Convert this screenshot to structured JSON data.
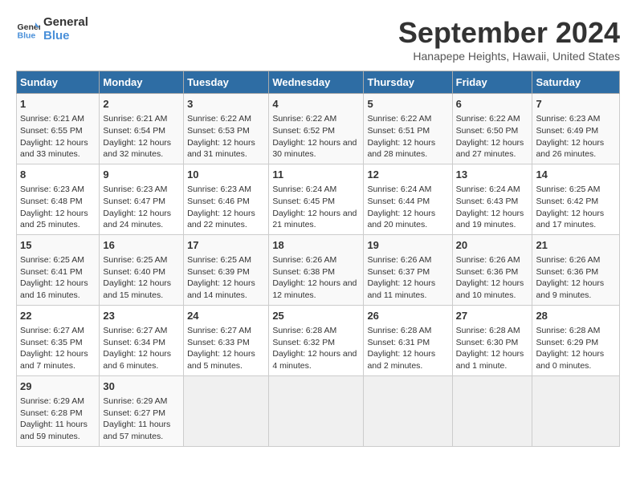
{
  "logo": {
    "line1": "General",
    "line2": "Blue"
  },
  "title": "September 2024",
  "subtitle": "Hanapepe Heights, Hawaii, United States",
  "headers": [
    "Sunday",
    "Monday",
    "Tuesday",
    "Wednesday",
    "Thursday",
    "Friday",
    "Saturday"
  ],
  "rows": [
    [
      {
        "day": "1",
        "rise": "6:21 AM",
        "set": "6:55 PM",
        "daylight": "12 hours and 33 minutes."
      },
      {
        "day": "2",
        "rise": "6:21 AM",
        "set": "6:54 PM",
        "daylight": "12 hours and 32 minutes."
      },
      {
        "day": "3",
        "rise": "6:22 AM",
        "set": "6:53 PM",
        "daylight": "12 hours and 31 minutes."
      },
      {
        "day": "4",
        "rise": "6:22 AM",
        "set": "6:52 PM",
        "daylight": "12 hours and 30 minutes."
      },
      {
        "day": "5",
        "rise": "6:22 AM",
        "set": "6:51 PM",
        "daylight": "12 hours and 28 minutes."
      },
      {
        "day": "6",
        "rise": "6:22 AM",
        "set": "6:50 PM",
        "daylight": "12 hours and 27 minutes."
      },
      {
        "day": "7",
        "rise": "6:23 AM",
        "set": "6:49 PM",
        "daylight": "12 hours and 26 minutes."
      }
    ],
    [
      {
        "day": "8",
        "rise": "6:23 AM",
        "set": "6:48 PM",
        "daylight": "12 hours and 25 minutes."
      },
      {
        "day": "9",
        "rise": "6:23 AM",
        "set": "6:47 PM",
        "daylight": "12 hours and 24 minutes."
      },
      {
        "day": "10",
        "rise": "6:23 AM",
        "set": "6:46 PM",
        "daylight": "12 hours and 22 minutes."
      },
      {
        "day": "11",
        "rise": "6:24 AM",
        "set": "6:45 PM",
        "daylight": "12 hours and 21 minutes."
      },
      {
        "day": "12",
        "rise": "6:24 AM",
        "set": "6:44 PM",
        "daylight": "12 hours and 20 minutes."
      },
      {
        "day": "13",
        "rise": "6:24 AM",
        "set": "6:43 PM",
        "daylight": "12 hours and 19 minutes."
      },
      {
        "day": "14",
        "rise": "6:25 AM",
        "set": "6:42 PM",
        "daylight": "12 hours and 17 minutes."
      }
    ],
    [
      {
        "day": "15",
        "rise": "6:25 AM",
        "set": "6:41 PM",
        "daylight": "12 hours and 16 minutes."
      },
      {
        "day": "16",
        "rise": "6:25 AM",
        "set": "6:40 PM",
        "daylight": "12 hours and 15 minutes."
      },
      {
        "day": "17",
        "rise": "6:25 AM",
        "set": "6:39 PM",
        "daylight": "12 hours and 14 minutes."
      },
      {
        "day": "18",
        "rise": "6:26 AM",
        "set": "6:38 PM",
        "daylight": "12 hours and 12 minutes."
      },
      {
        "day": "19",
        "rise": "6:26 AM",
        "set": "6:37 PM",
        "daylight": "12 hours and 11 minutes."
      },
      {
        "day": "20",
        "rise": "6:26 AM",
        "set": "6:36 PM",
        "daylight": "12 hours and 10 minutes."
      },
      {
        "day": "21",
        "rise": "6:26 AM",
        "set": "6:36 PM",
        "daylight": "12 hours and 9 minutes."
      }
    ],
    [
      {
        "day": "22",
        "rise": "6:27 AM",
        "set": "6:35 PM",
        "daylight": "12 hours and 7 minutes."
      },
      {
        "day": "23",
        "rise": "6:27 AM",
        "set": "6:34 PM",
        "daylight": "12 hours and 6 minutes."
      },
      {
        "day": "24",
        "rise": "6:27 AM",
        "set": "6:33 PM",
        "daylight": "12 hours and 5 minutes."
      },
      {
        "day": "25",
        "rise": "6:28 AM",
        "set": "6:32 PM",
        "daylight": "12 hours and 4 minutes."
      },
      {
        "day": "26",
        "rise": "6:28 AM",
        "set": "6:31 PM",
        "daylight": "12 hours and 2 minutes."
      },
      {
        "day": "27",
        "rise": "6:28 AM",
        "set": "6:30 PM",
        "daylight": "12 hours and 1 minute."
      },
      {
        "day": "28",
        "rise": "6:28 AM",
        "set": "6:29 PM",
        "daylight": "12 hours and 0 minutes."
      }
    ],
    [
      {
        "day": "29",
        "rise": "6:29 AM",
        "set": "6:28 PM",
        "daylight": "11 hours and 59 minutes."
      },
      {
        "day": "30",
        "rise": "6:29 AM",
        "set": "6:27 PM",
        "daylight": "11 hours and 57 minutes."
      },
      null,
      null,
      null,
      null,
      null
    ]
  ],
  "labels": {
    "sunrise": "Sunrise:",
    "sunset": "Sunset:",
    "daylight": "Daylight:"
  }
}
